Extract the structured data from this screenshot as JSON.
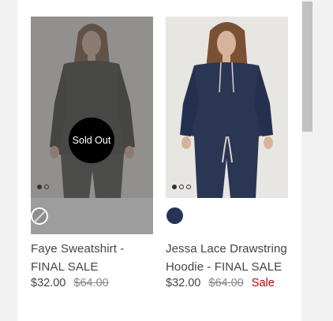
{
  "products": [
    {
      "title": "Faye Sweatshirt - FINAL SALE",
      "price": "$32.00",
      "compare_price": "$64.00",
      "badge": "Sold Out",
      "swatch_color": "#8e8e8e",
      "image_colors": {
        "background": "#d6d3ce",
        "garment": "#343430",
        "skin": "#c9a58c",
        "hair": "#6b4a33"
      }
    },
    {
      "title": "Jessa Lace Drawstring Hoodie - FINAL SALE",
      "price": "$32.00",
      "compare_price": "$64.00",
      "sale_label": "Sale",
      "swatch_color": "#263457",
      "image_colors": {
        "background": "#e8e6e2",
        "garment": "#2b3554",
        "skin": "#d7b39b",
        "hair": "#7a5134"
      }
    }
  ]
}
